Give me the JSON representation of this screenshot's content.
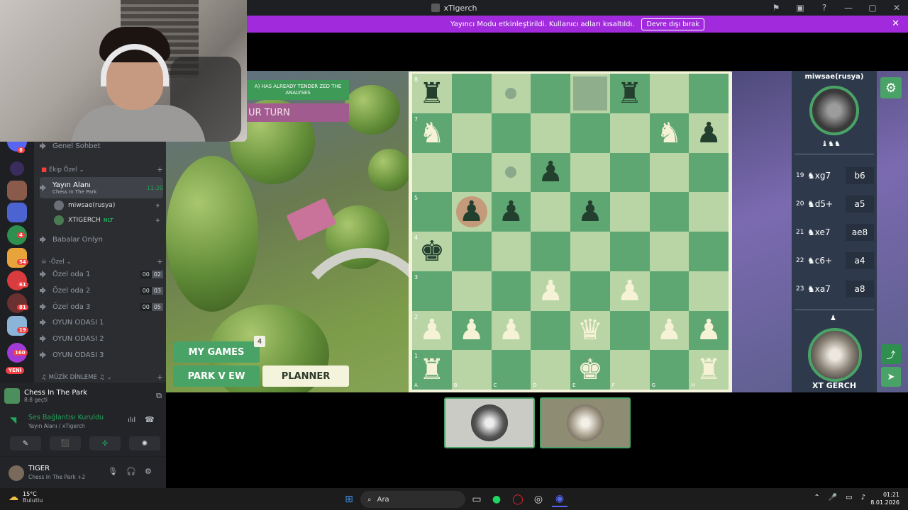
{
  "window": {
    "title": "xTigerch",
    "controls": [
      "⚑",
      "▣",
      "?",
      "—",
      "▢",
      "✕"
    ]
  },
  "banner": {
    "text": "Yayıncı Modu etkinleştirildi. Kullanıcı adları kısaltıldı.",
    "button": "Devre dışı bırak",
    "close": "✕"
  },
  "discord": {
    "servers": [
      {
        "badge": "6"
      },
      {
        "badge": ""
      },
      {
        "badge": ""
      },
      {
        "badge": ""
      },
      {
        "badge": "4"
      },
      {
        "badge": "54"
      },
      {
        "badge": "61"
      },
      {
        "badge": "81"
      },
      {
        "badge": "19"
      },
      {
        "badge": "160"
      }
    ],
    "yeni": "YENİ",
    "partial_channel": "Genel Sohbet",
    "category_ekip": "Ekip Özel",
    "active_channel": {
      "name": "Yayın Alanı",
      "sub": "Chess In The Park",
      "time": "11:20"
    },
    "members": [
      {
        "name": "miwsae(rusya)",
        "tag": ""
      },
      {
        "name": "XTIGERCH",
        "tag": "NLT"
      }
    ],
    "channel_babalar": "Babalar Onlyn",
    "category_ozel": "-Özel",
    "channels": [
      {
        "name": "Özel oda 1",
        "c1": "00",
        "c2": "02"
      },
      {
        "name": "Özel oda 2",
        "c1": "00",
        "c2": "03"
      },
      {
        "name": "Özel oda 3",
        "c1": "00",
        "c2": "05"
      },
      {
        "name": "OYUN ODASI 1"
      },
      {
        "name": "OYUN ODASI 2"
      },
      {
        "name": "OYUN ODASI 3"
      }
    ],
    "category_muzik": "MÜZİK DİNLEME",
    "activity": {
      "title": "Chess In The Park",
      "sub": "8:8 geçti"
    },
    "connection": {
      "status": "Ses Bağlantısı Kuruldu",
      "detail": "Yayın Alanı / xTigerch"
    },
    "voice_buttons": [
      "✎",
      "⬛",
      "✣",
      "✺"
    ],
    "user": {
      "name": "TIGER",
      "status": "Chess In The Park +2"
    }
  },
  "game": {
    "notif": "A) HAS ALREADY TENDER ZED THE ANALYSES",
    "turn": "UR TURN",
    "my_games": "MY GAMES",
    "my_games_count": "4",
    "park_view": "PARK V EW",
    "planner": "PLANNER",
    "ranks": [
      "8",
      "7",
      "",
      "5",
      "4",
      "3",
      "2",
      "1"
    ],
    "files": [
      "A",
      "B",
      "C",
      "D",
      "E",
      "F",
      "G",
      "H"
    ],
    "pieces": [
      {
        "sq": "a8",
        "glyph": "♜",
        "color": "b"
      },
      {
        "sq": "f8",
        "glyph": "♜",
        "color": "b"
      },
      {
        "sq": "a7",
        "glyph": "♞",
        "color": "w"
      },
      {
        "sq": "g7",
        "glyph": "♞",
        "color": "w"
      },
      {
        "sq": "h7",
        "glyph": "♟",
        "color": "b"
      },
      {
        "sq": "d6",
        "glyph": "♟",
        "color": "b"
      },
      {
        "sq": "b5",
        "glyph": "♟",
        "color": "b"
      },
      {
        "sq": "c5",
        "glyph": "♟",
        "color": "b"
      },
      {
        "sq": "e5",
        "glyph": "♟",
        "color": "b"
      },
      {
        "sq": "a4",
        "glyph": "♚",
        "color": "b"
      },
      {
        "sq": "d3",
        "glyph": "♟",
        "color": "w"
      },
      {
        "sq": "f3",
        "glyph": "♟",
        "color": "w"
      },
      {
        "sq": "a2",
        "glyph": "♟",
        "color": "w"
      },
      {
        "sq": "b2",
        "glyph": "♟",
        "color": "w"
      },
      {
        "sq": "c2",
        "glyph": "♟",
        "color": "w"
      },
      {
        "sq": "e2",
        "glyph": "♛",
        "color": "w"
      },
      {
        "sq": "g2",
        "glyph": "♟",
        "color": "w"
      },
      {
        "sq": "h2",
        "glyph": "♟",
        "color": "w"
      },
      {
        "sq": "a1",
        "glyph": "♜",
        "color": "w"
      },
      {
        "sq": "e1",
        "glyph": "♚",
        "color": "w"
      },
      {
        "sq": "h1",
        "glyph": "♜",
        "color": "w"
      }
    ],
    "hints": [
      "c8",
      "c6"
    ],
    "highlight_circle": "b5",
    "highlight_square": "e8",
    "opponent": {
      "name": "miwsae(rusya)",
      "captured": "♝♞♞"
    },
    "moves": [
      {
        "n": "19",
        "w": "♞xg7",
        "b": "b6"
      },
      {
        "n": "20",
        "w": "♞d5+",
        "b": "a5"
      },
      {
        "n": "21",
        "w": "♞xe7",
        "b": "ae8"
      },
      {
        "n": "22",
        "w": "♞c6+",
        "b": "a4"
      },
      {
        "n": "23",
        "w": "♞xa7",
        "b": "a8"
      }
    ],
    "me": {
      "name": "XT GERCH",
      "captured": "♟"
    },
    "settings_icon": "⚙",
    "share_icon": "⤴",
    "send_icon": "➤"
  },
  "taskbar": {
    "temp": "15°C",
    "weather": "Bulutlu",
    "search": "Ara",
    "time": "01:21",
    "date": "8.01.2026",
    "tray": [
      "⌃",
      "🎤",
      "▭",
      "♪"
    ]
  }
}
